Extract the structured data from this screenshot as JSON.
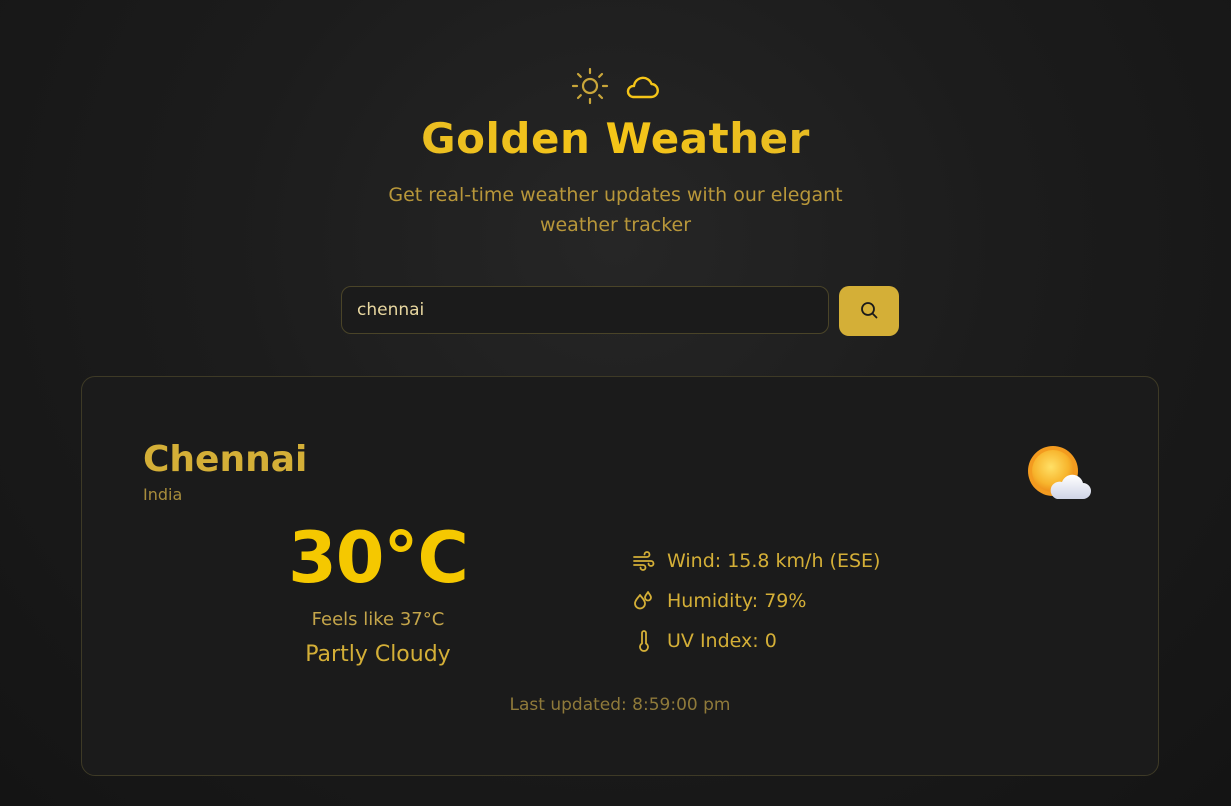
{
  "header": {
    "icons": [
      "sun-icon",
      "cloud-icon"
    ],
    "title": "Golden Weather",
    "subtitle": "Get real-time weather updates with our elegant weather tracker"
  },
  "search": {
    "value": "chennai",
    "button_icon": "search-icon"
  },
  "weather": {
    "city": "Chennai",
    "country": "India",
    "condition_icon": "partly-cloudy-icon",
    "temperature": "30°C",
    "feels_like": "Feels like 37°C",
    "condition": "Partly Cloudy",
    "stats": [
      {
        "icon": "wind-icon",
        "label": "Wind: 15.8 km/h (ESE)"
      },
      {
        "icon": "droplets-icon",
        "label": "Humidity: 79%"
      },
      {
        "icon": "thermometer-icon",
        "label": "UV Index: 0"
      }
    ],
    "last_updated": "Last updated: 8:59:00 pm"
  },
  "colors": {
    "gold": "#d4af37",
    "bright_gold": "#f5c800",
    "background": "#1b1b1b"
  }
}
